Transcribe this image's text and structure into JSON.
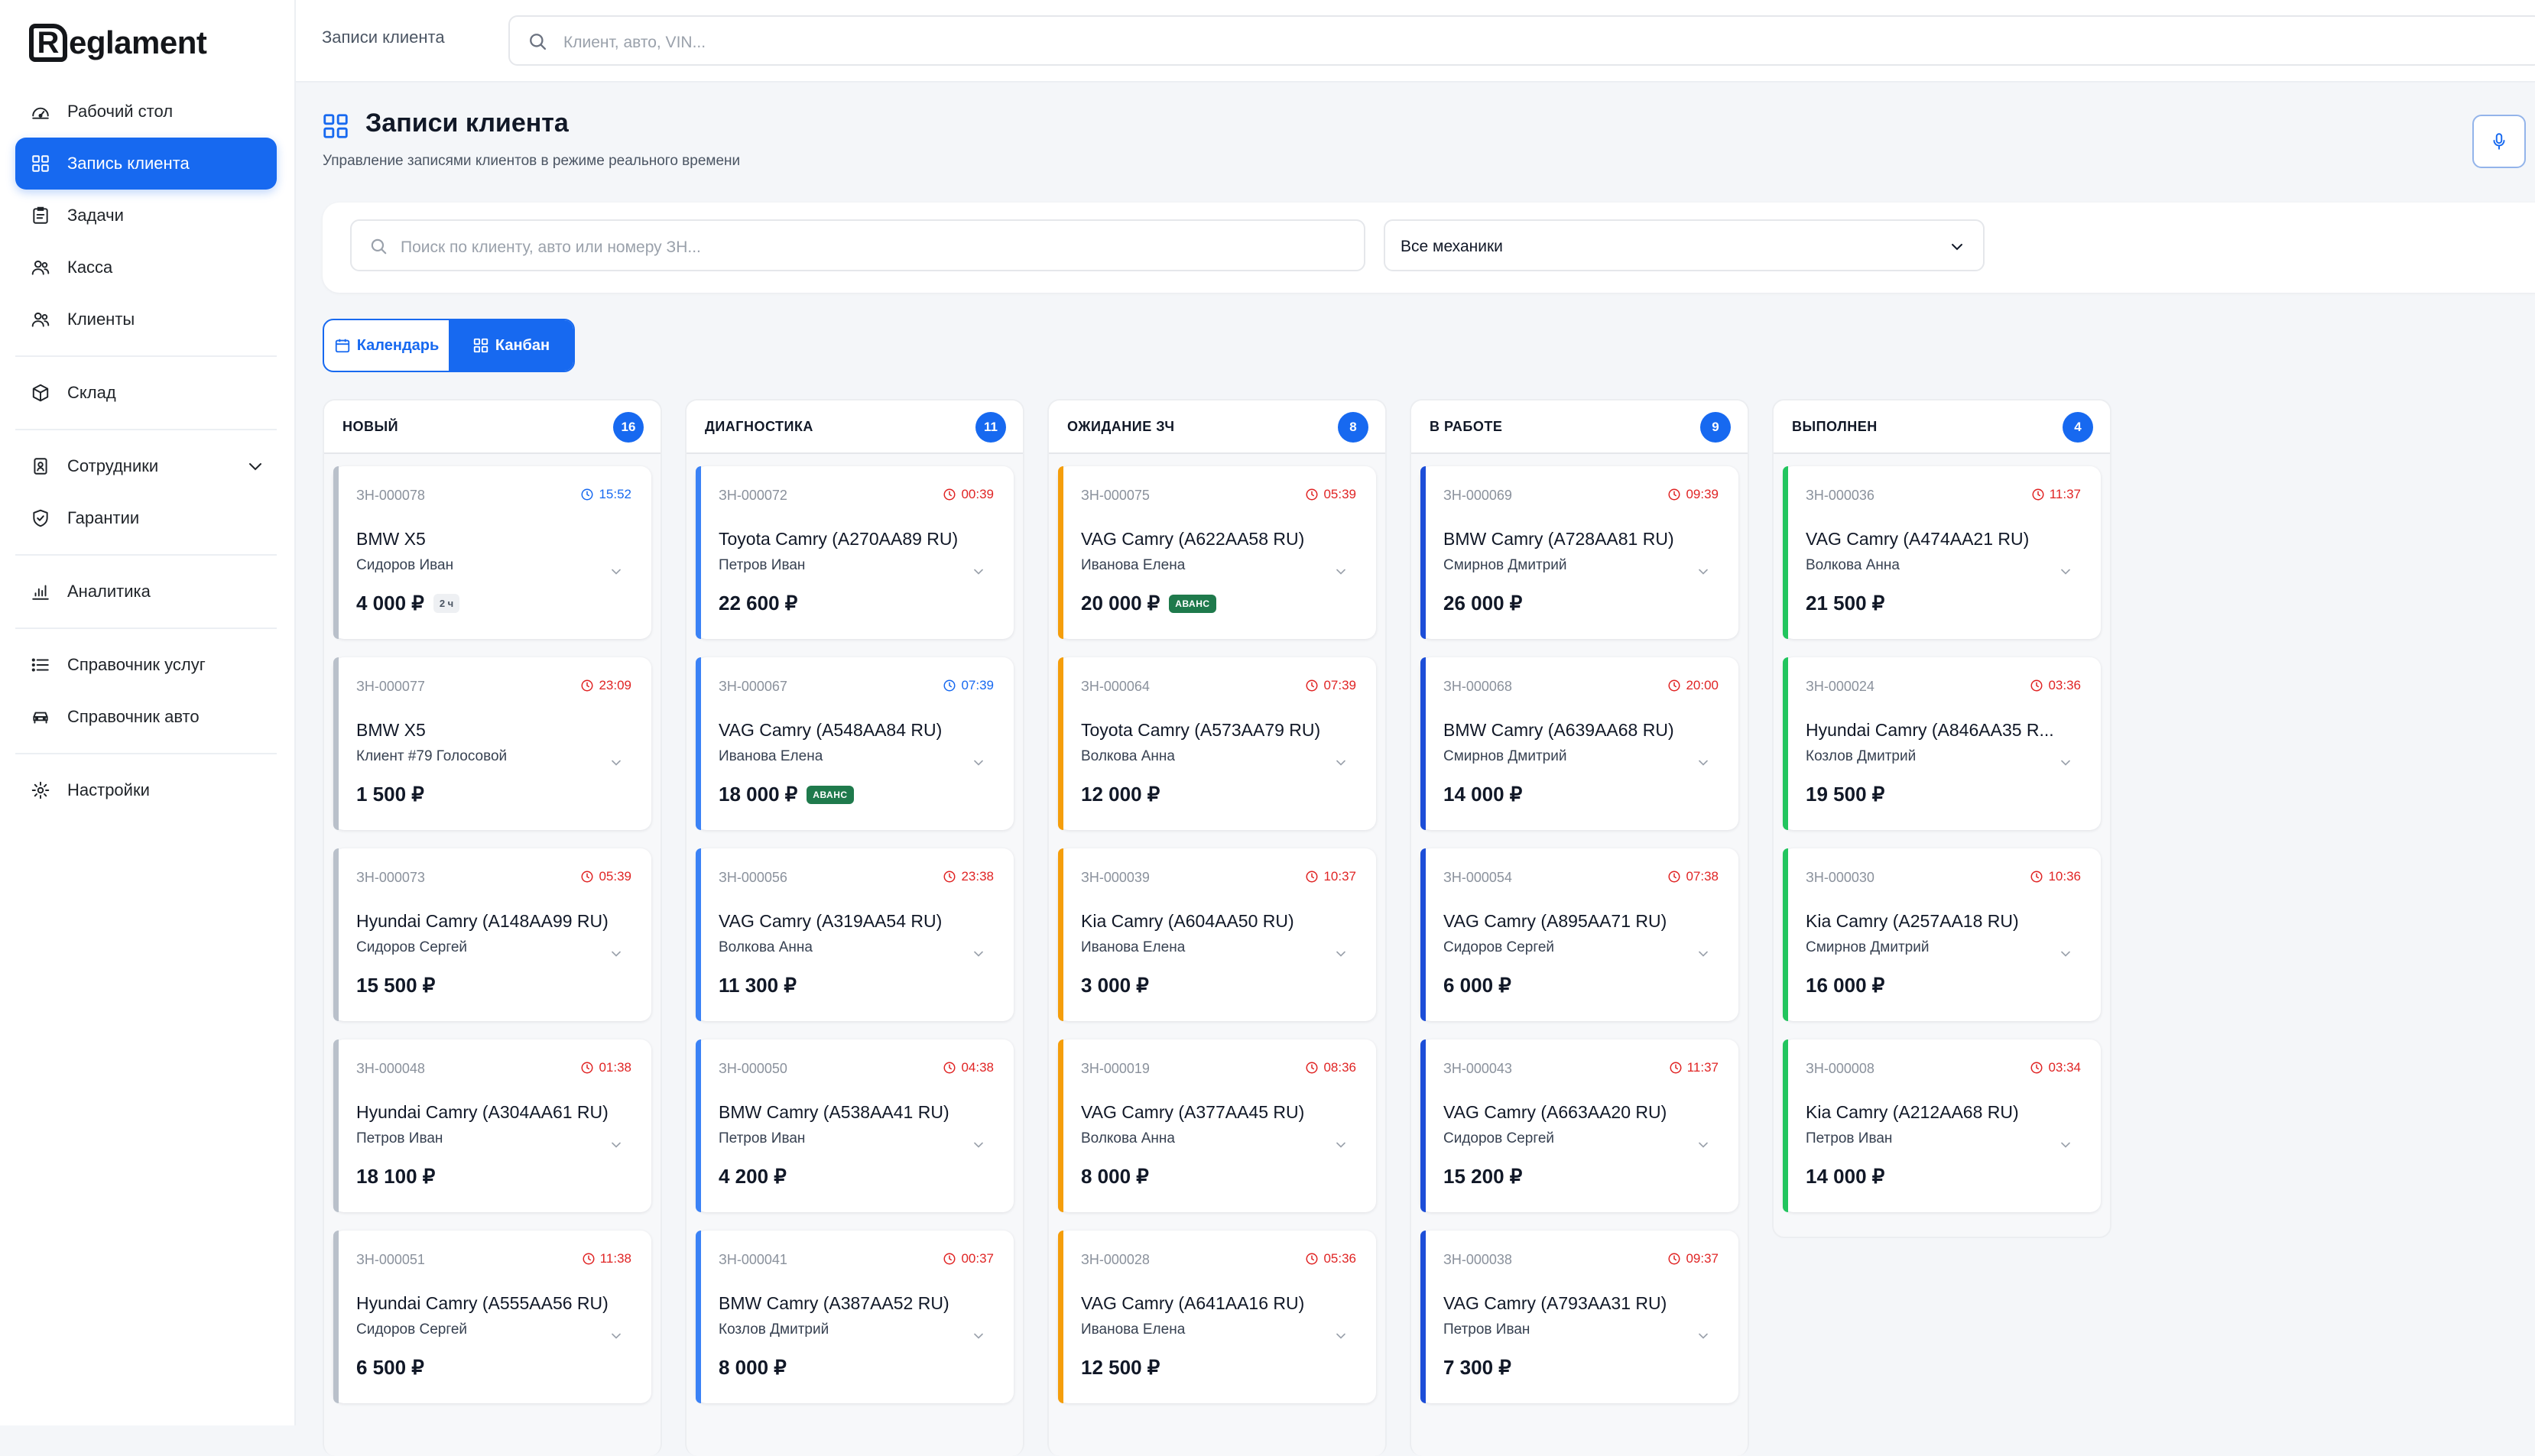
{
  "brand": {
    "logo_letter": "R",
    "name": "eglament"
  },
  "sidebar": {
    "items": [
      {
        "key": "desktop",
        "label": "Рабочий стол",
        "icon": "dashboard-gauge-icon"
      },
      {
        "key": "records",
        "label": "Запись клиента",
        "icon": "grid-icon",
        "active": true
      },
      {
        "key": "tasks",
        "label": "Задачи",
        "icon": "clipboard-list-icon"
      },
      {
        "key": "cash",
        "label": "Касса",
        "icon": "users-icon"
      },
      {
        "key": "clients",
        "label": "Клиенты",
        "icon": "users-icon"
      },
      {
        "key": "warehouse",
        "label": "Склад",
        "icon": "box-icon"
      },
      {
        "key": "staff",
        "label": "Сотрудники",
        "icon": "id-badge-icon",
        "expandable": true
      },
      {
        "key": "warranty",
        "label": "Гарантии",
        "icon": "shield-check-icon"
      },
      {
        "key": "analytics",
        "label": "Аналитика",
        "icon": "bar-chart-icon"
      },
      {
        "key": "services",
        "label": "Справочник услуг",
        "icon": "list-icon"
      },
      {
        "key": "cars",
        "label": "Справочник авто",
        "icon": "car-icon"
      },
      {
        "key": "settings",
        "label": "Настройки",
        "icon": "gear-icon"
      }
    ]
  },
  "topbar": {
    "breadcrumb": "Записи клиента",
    "search_placeholder": "Клиент, авто, VIN..."
  },
  "page": {
    "title": "Записи клиента",
    "subtitle": "Управление записями клиентов в режиме реального времени"
  },
  "filters": {
    "search_placeholder": "Поиск по клиенту, авто или номеру ЗН...",
    "mechanic_select": "Все механики"
  },
  "view_toggle": {
    "calendar": "Календарь",
    "kanban": "Канбан",
    "active": "kanban"
  },
  "colors": {
    "accent": "#1769f0",
    "new": "#b9c0ca",
    "diagnostics": "#3b82f6",
    "waiting_parts": "#f59e0b",
    "in_work": "#1d4ed8",
    "done": "#22c55e",
    "time_overdue": "#e02424",
    "time_ok": "#1769f0"
  },
  "columns": [
    {
      "title": "НОВЫЙ",
      "count": "16",
      "stripe": "#b9c0ca",
      "cards": [
        {
          "id": "ЗН-000078",
          "time": "15:52",
          "time_state": "blue",
          "car": "BMW X5",
          "client": "Сидоров Иван",
          "price": "4 000 ₽",
          "duration": "2 ч"
        },
        {
          "id": "ЗН-000077",
          "time": "23:09",
          "time_state": "red",
          "car": "BMW X5",
          "client": "Клиент #79 Голосовой",
          "price": "1 500 ₽"
        },
        {
          "id": "ЗН-000073",
          "time": "05:39",
          "time_state": "red",
          "car": "Hyundai Camry (А148АА99 RU)",
          "client": "Сидоров Сергей",
          "price": "15 500 ₽"
        },
        {
          "id": "ЗН-000048",
          "time": "01:38",
          "time_state": "red",
          "car": "Hyundai Camry (А304АА61 RU)",
          "client": "Петров Иван",
          "price": "18 100 ₽"
        },
        {
          "id": "ЗН-000051",
          "time": "11:38",
          "time_state": "red",
          "car": "Hyundai Camry (А555АА56 RU)",
          "client": "Сидоров Сергей",
          "price": "6 500 ₽"
        }
      ]
    },
    {
      "title": "ДИАГНОСТИКА",
      "count": "11",
      "stripe": "#3b82f6",
      "cards": [
        {
          "id": "ЗН-000072",
          "time": "00:39",
          "time_state": "red",
          "car": "Toyota Camry (А270АА89 RU)",
          "client": "Петров Иван",
          "price": "22 600 ₽"
        },
        {
          "id": "ЗН-000067",
          "time": "07:39",
          "time_state": "blue",
          "car": "VAG Camry (А548АА84 RU)",
          "client": "Иванова Елена",
          "price": "18 000 ₽",
          "avans": "АВАНС"
        },
        {
          "id": "ЗН-000056",
          "time": "23:38",
          "time_state": "red",
          "car": "VAG Camry (А319АА54 RU)",
          "client": "Волкова Анна",
          "price": "11 300 ₽"
        },
        {
          "id": "ЗН-000050",
          "time": "04:38",
          "time_state": "red",
          "car": "BMW Camry (А538АА41 RU)",
          "client": "Петров Иван",
          "price": "4 200 ₽"
        },
        {
          "id": "ЗН-000041",
          "time": "00:37",
          "time_state": "red",
          "car": "BMW Camry (А387АА52 RU)",
          "client": "Козлов Дмитрий",
          "price": "8 000 ₽"
        }
      ]
    },
    {
      "title": "ОЖИДАНИЕ ЗЧ",
      "count": "8",
      "stripe": "#f59e0b",
      "cards": [
        {
          "id": "ЗН-000075",
          "time": "05:39",
          "time_state": "red",
          "car": "VAG Camry (А622АА58 RU)",
          "client": "Иванова Елена",
          "price": "20 000 ₽",
          "avans": "АВАНС"
        },
        {
          "id": "ЗН-000064",
          "time": "07:39",
          "time_state": "red",
          "car": "Toyota Camry (А573АА79 RU)",
          "client": "Волкова Анна",
          "price": "12 000 ₽"
        },
        {
          "id": "ЗН-000039",
          "time": "10:37",
          "time_state": "red",
          "car": "Kia Camry (А604АА50 RU)",
          "client": "Иванова Елена",
          "price": "3 000 ₽"
        },
        {
          "id": "ЗН-000019",
          "time": "08:36",
          "time_state": "red",
          "car": "VAG Camry (А377АА45 RU)",
          "client": "Волкова Анна",
          "price": "8 000 ₽"
        },
        {
          "id": "ЗН-000028",
          "time": "05:36",
          "time_state": "red",
          "car": "VAG Camry (А641АА16 RU)",
          "client": "Иванова Елена",
          "price": "12 500 ₽"
        }
      ]
    },
    {
      "title": "В РАБОТЕ",
      "count": "9",
      "stripe": "#1d4ed8",
      "cards": [
        {
          "id": "ЗН-000069",
          "time": "09:39",
          "time_state": "red",
          "car": "BMW Camry (А728АА81 RU)",
          "client": "Смирнов Дмитрий",
          "price": "26 000 ₽"
        },
        {
          "id": "ЗН-000068",
          "time": "20:00",
          "time_state": "red",
          "car": "BMW Camry (А639АА68 RU)",
          "client": "Смирнов Дмитрий",
          "price": "14 000 ₽"
        },
        {
          "id": "ЗН-000054",
          "time": "07:38",
          "time_state": "red",
          "car": "VAG Camry (А895АА71 RU)",
          "client": "Сидоров Сергей",
          "price": "6 000 ₽"
        },
        {
          "id": "ЗН-000043",
          "time": "11:37",
          "time_state": "red",
          "car": "VAG Camry (А663АА20 RU)",
          "client": "Сидоров Сергей",
          "price": "15 200 ₽"
        },
        {
          "id": "ЗН-000038",
          "time": "09:37",
          "time_state": "red",
          "car": "VAG Camry (А793АА31 RU)",
          "client": "Петров Иван",
          "price": "7 300 ₽"
        }
      ]
    },
    {
      "title": "ВЫПОЛНЕН",
      "count": "4",
      "stripe": "#22c55e",
      "cards": [
        {
          "id": "ЗН-000036",
          "time": "11:37",
          "time_state": "red",
          "car": "VAG Camry (А474АА21 RU)",
          "client": "Волкова Анна",
          "price": "21 500 ₽"
        },
        {
          "id": "ЗН-000024",
          "time": "03:36",
          "time_state": "red",
          "car": "Hyundai Camry (А846АА35 R...",
          "client": "Козлов Дмитрий",
          "price": "19 500 ₽"
        },
        {
          "id": "ЗН-000030",
          "time": "10:36",
          "time_state": "red",
          "car": "Kia Camry (А257АА18 RU)",
          "client": "Смирнов Дмитрий",
          "price": "16 000 ₽"
        },
        {
          "id": "ЗН-000008",
          "time": "03:34",
          "time_state": "red",
          "car": "Kia Camry (А212АА68 RU)",
          "client": "Петров Иван",
          "price": "14 000 ₽"
        }
      ]
    }
  ]
}
